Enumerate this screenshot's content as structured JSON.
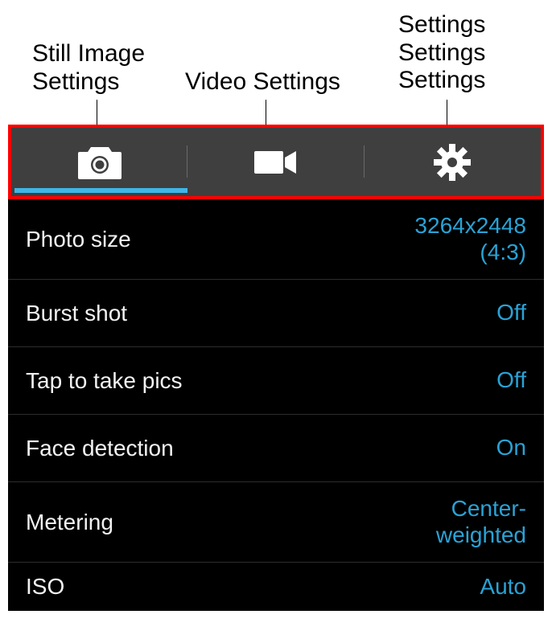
{
  "annotations": {
    "still": "Still Image\nSettings",
    "video": "Video Settings",
    "gear": "Settings\nSettings\nSettings"
  },
  "tabs": {
    "still_icon": "camera-icon",
    "video_icon": "video-icon",
    "gear_icon": "gear-icon",
    "active_index": 0
  },
  "settings": [
    {
      "label": "Photo size",
      "value": "3264x2448\n(4:3)"
    },
    {
      "label": "Burst shot",
      "value": "Off"
    },
    {
      "label": "Tap to take pics",
      "value": "Off"
    },
    {
      "label": "Face detection",
      "value": "On"
    },
    {
      "label": "Metering",
      "value": "Center-\nweighted"
    },
    {
      "label": "ISO",
      "value": "Auto"
    }
  ]
}
